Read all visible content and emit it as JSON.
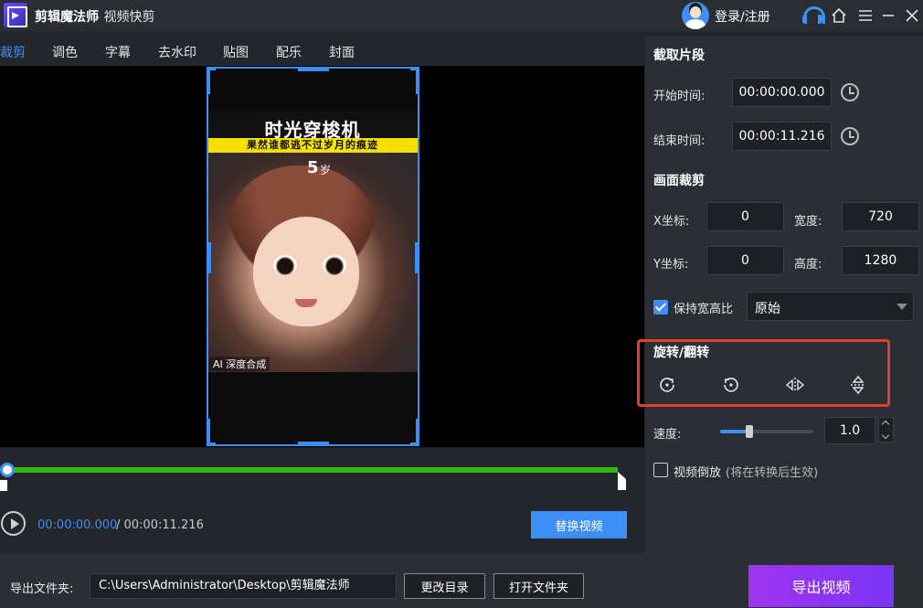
{
  "app": {
    "title": "剪辑魔法师",
    "subtitle": "- 视频快剪",
    "login": "登录/注册"
  },
  "tabs": [
    "裁剪",
    "调色",
    "字幕",
    "去水印",
    "贴图",
    "配乐",
    "封面"
  ],
  "video": {
    "title": "时光穿梭机",
    "banner": "果然谁都逃不过岁月的痕迹",
    "age_number": "5",
    "age_unit": "岁",
    "ai_label": "AI 深度合成"
  },
  "timeline": {
    "current_time": "00:00:00.000",
    "total_time": "/ 00:00:11.216",
    "replace_button": "替换视频"
  },
  "panel": {
    "clip_title": "截取片段",
    "start_label": "开始时间:",
    "start_value": "00:00:00.000",
    "end_label": "结束时间:",
    "end_value": "00:00:11.216",
    "crop_title": "画面裁剪",
    "x_label": "X坐标:",
    "x_value": "0",
    "width_label": "宽度:",
    "width_value": "720",
    "y_label": "Y坐标:",
    "y_value": "0",
    "height_label": "高度:",
    "height_value": "1280",
    "keep_ratio_label": "保持宽高比",
    "keep_ratio_checked": true,
    "ratio_option": "原始",
    "rotate_title": "旋转/翻转",
    "speed_label": "速度:",
    "speed_value": "1.0",
    "reverse_label": "视频倒放",
    "reverse_note": "(将在转换后生效)",
    "reverse_checked": false
  },
  "footer": {
    "export_folder_label": "导出文件夹:",
    "export_path": "C:\\Users\\Administrator\\Desktop\\剪辑魔法师",
    "change_dir": "更改目录",
    "open_folder": "打开文件夹",
    "export_video": "导出视频"
  },
  "colors": {
    "accent": "#3d8ff5",
    "track": "#35b80f",
    "highlight": "#e0402a",
    "export_gradient": [
      "#a034f0",
      "#7a35f5"
    ]
  }
}
